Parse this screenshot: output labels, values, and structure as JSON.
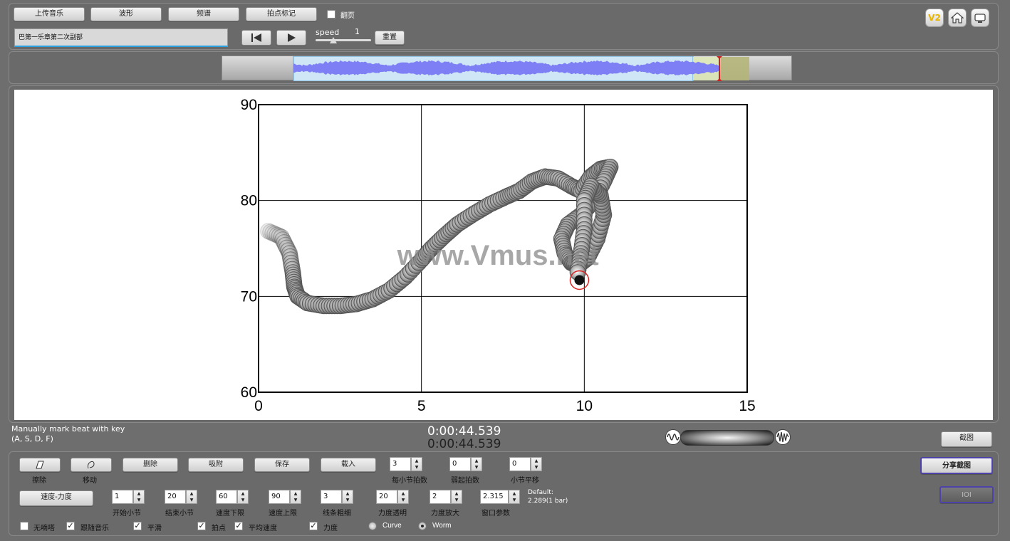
{
  "toolbar": {
    "upload_music": "上传音乐",
    "waveform": "波形",
    "spectrum": "频谱",
    "beat_mark": "拍点标记",
    "page_turn_label": "翻页",
    "page_turn_checked": false,
    "track_title": "巴第一乐章第二次副部",
    "speed_label": "speed",
    "speed_value": "1",
    "reset": "重置"
  },
  "top_right": {
    "version_badge": "V2",
    "home_icon": "home-icon",
    "screen_icon": "screen-icon"
  },
  "waveform_overview": {
    "wave_color": "#7f7ff5",
    "selection_color": "#cde8ff",
    "window_color": "#b5b57a",
    "playhead_color": "#cc2222"
  },
  "watermark": "www.Vmus.net",
  "chart_data": {
    "type": "scatter",
    "title": "",
    "xlabel": "",
    "ylabel": "",
    "xlim": [
      0,
      15
    ],
    "ylim": [
      60,
      90
    ],
    "x_ticks": [
      "0",
      "5",
      "10",
      "15"
    ],
    "y_ticks": [
      "60",
      "70",
      "80",
      "90"
    ],
    "grid": true,
    "marker_color": "#8a8a8a",
    "current_marker_color": "#dd2222",
    "series": [
      {
        "x": [
          0.3,
          0.7,
          0.95,
          1.05,
          1.1,
          1.2,
          1.5,
          2.0,
          2.5,
          3.0,
          3.5,
          4.0,
          4.5,
          5.0,
          5.3,
          5.7,
          6.1,
          6.6,
          7.1,
          7.6,
          8.0,
          8.4,
          8.8,
          9.2,
          9.6,
          9.9,
          10.2,
          10.5,
          10.8,
          10.6,
          10.3,
          9.9,
          9.5,
          9.3,
          9.4,
          9.6,
          9.8,
          10.1,
          10.4,
          10.6,
          10.5,
          10.2,
          10.0,
          10.0,
          9.9,
          9.8
        ],
        "y": [
          76.8,
          76.2,
          74.5,
          72.5,
          71.0,
          70.0,
          69.3,
          69.0,
          69.0,
          69.2,
          69.7,
          70.6,
          72.0,
          73.8,
          75.0,
          76.3,
          77.5,
          78.6,
          79.6,
          80.4,
          81.0,
          82.0,
          82.5,
          82.3,
          81.5,
          81.0,
          82.5,
          83.3,
          83.5,
          82.0,
          80.0,
          78.5,
          77.5,
          76.0,
          74.5,
          73.5,
          73.2,
          74.0,
          76.0,
          78.5,
          80.5,
          81.5,
          80.0,
          77.0,
          74.5,
          72.5
        ]
      }
    ],
    "current_point": {
      "x": 9.85,
      "y": 71.7
    }
  },
  "status": {
    "manual_mark": "Manually mark beat with key",
    "manual_keys": "(A, S, D, F)",
    "time1": "0:00:44.539",
    "time2": "0:00:44.539",
    "screenshot": "截图"
  },
  "controls": {
    "erase": "擦除",
    "move": "移动",
    "delete": "删除",
    "snap": "吸附",
    "save": "保存",
    "load": "载入",
    "beats_per_bar_label": "每小节拍数",
    "beats_per_bar": "3",
    "weak_beats_label": "弱起拍数",
    "weak_beats": "0",
    "bar_offset_label": "小节平移",
    "bar_offset": "0",
    "share_screenshot": "分享截图",
    "io_button": "IOI",
    "tempo_dynamics": "速度-力度",
    "start_bar_label": "开始小节",
    "start_bar": "1",
    "end_bar_label": "结束小节",
    "end_bar": "20",
    "tempo_min_label": "速度下限",
    "tempo_min": "60",
    "tempo_max_label": "速度上限",
    "tempo_max": "90",
    "line_width_label": "线条粗细",
    "line_width": "3",
    "dyn_transparency_label": "力度透明",
    "dyn_transparency": "20",
    "dyn_scale_label": "力度放大",
    "dyn_scale": "2",
    "window_param_label": "窗口参数",
    "window_param": "2.315",
    "default_label": "Default:",
    "default_value": "2.289(1 bar)",
    "no_beep": "无嘀嗒",
    "follow_music": "跟随音乐",
    "smooth": "平滑",
    "beat_point": "拍点",
    "avg_tempo": "平均速度",
    "dynamics": "力度",
    "curve": "Curve",
    "worm": "Worm"
  }
}
